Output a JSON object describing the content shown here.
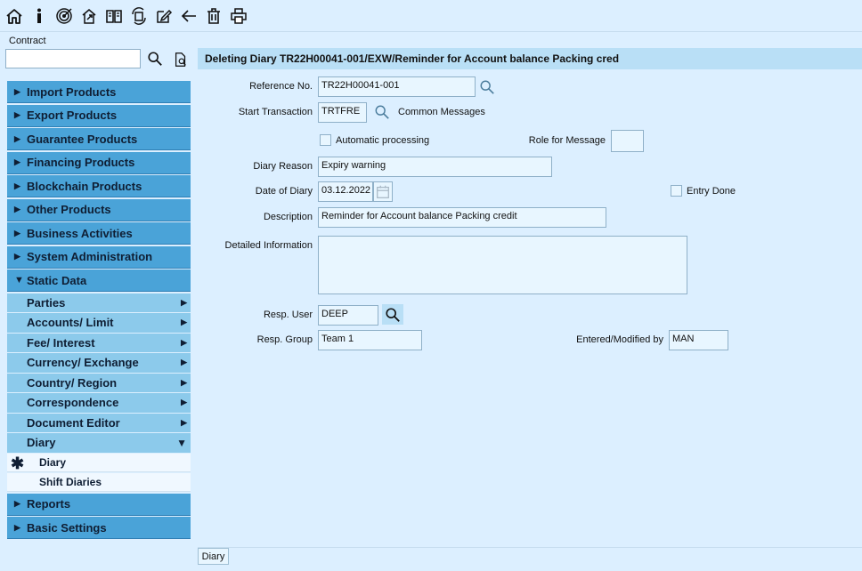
{
  "toolbar": {
    "icons": [
      "home-icon",
      "info-icon",
      "target-icon",
      "export-arrows-icon",
      "book-icon",
      "refresh-document-icon",
      "edit-icon",
      "back-arrow-icon",
      "trash-icon",
      "print-icon"
    ]
  },
  "contract": {
    "label": "Contract",
    "value": "",
    "placeholder": ""
  },
  "sidebar": {
    "main_top": [
      {
        "label": "Import Products"
      },
      {
        "label": "Export Products"
      },
      {
        "label": "Guarantee Products"
      },
      {
        "label": "Financing Products"
      },
      {
        "label": "Blockchain Products"
      },
      {
        "label": "Other Products"
      },
      {
        "label": "Business Activities"
      },
      {
        "label": "System Administration"
      },
      {
        "label": "Static Data"
      }
    ],
    "sub": [
      {
        "label": "Parties"
      },
      {
        "label": "Accounts/ Limit"
      },
      {
        "label": "Fee/ Interest"
      },
      {
        "label": "Currency/ Exchange"
      },
      {
        "label": "Country/ Region"
      },
      {
        "label": "Correspondence"
      },
      {
        "label": "Document Editor"
      },
      {
        "label": "Diary"
      }
    ],
    "leaves": [
      {
        "label": "Diary",
        "marker": "✱"
      },
      {
        "label": "Shift Diaries"
      }
    ],
    "main_bottom": [
      {
        "label": "Reports"
      },
      {
        "label": "Basic Settings"
      }
    ]
  },
  "main": {
    "title": "Deleting Diary TR22H00041-001/EXW/Reminder for Account balance Packing cred",
    "reference_no": {
      "label": "Reference No.",
      "value": "TR22H00041-001"
    },
    "start_transaction": {
      "label": "Start Transaction",
      "value": "TRTFRE",
      "link": "Common Messages"
    },
    "automatic_processing": {
      "label": "Automatic processing"
    },
    "role_for_message": {
      "label": "Role for Message",
      "value": ""
    },
    "diary_reason": {
      "label": "Diary Reason",
      "value": "Expiry warning"
    },
    "date_of_diary": {
      "label": "Date of Diary",
      "value": "03.12.2022"
    },
    "entry_done": {
      "label": "Entry Done"
    },
    "description": {
      "label": "Description",
      "value": "Reminder for Account balance Packing credit"
    },
    "detailed_information": {
      "label": "Detailed Information",
      "value": ""
    },
    "resp_user": {
      "label": "Resp. User",
      "value": "DEEP"
    },
    "resp_group": {
      "label": "Resp. Group",
      "value": "Team 1"
    },
    "entered_modified_by": {
      "label": "Entered/Modified by",
      "value": "MAN"
    }
  },
  "bottom_tab": {
    "label": "Diary"
  }
}
